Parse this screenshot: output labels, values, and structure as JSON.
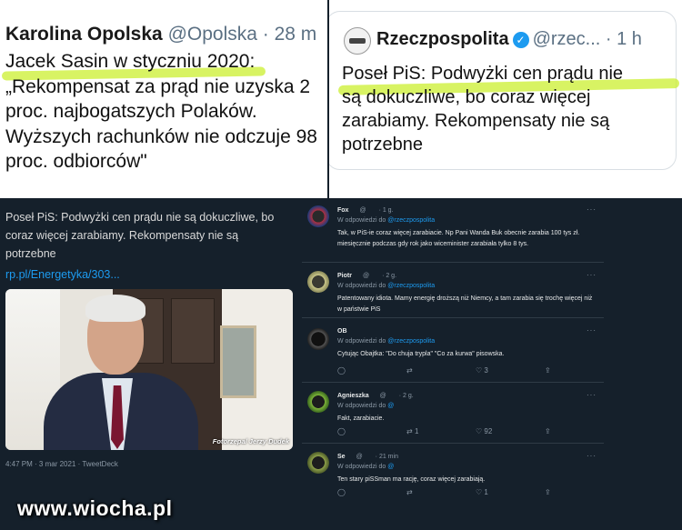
{
  "top_left": {
    "name": "Karolina Opolska",
    "handle": "@Opolska",
    "time": "· 28 m",
    "lines": [
      "Jacek Sasin w styczniu 2020:",
      "„Rekompensat za prąd nie uzyska 2",
      "proc. najbogatszych Polaków.",
      "Wyższych rachunków nie odczuje 98",
      "proc. odbiorców\""
    ]
  },
  "top_right": {
    "name": "Rzeczpospolita",
    "verified": "✓",
    "handle": "@rzec...",
    "time": "· 1 h",
    "lines": [
      "Poseł PiS: Podwyżki cen prądu nie",
      "są dokuczliwe, bo coraz więcej",
      "zarabiamy. Rekompensaty nie są",
      "potrzebne"
    ]
  },
  "main_tweet": {
    "text": "Poseł PiS: Podwyżki cen prądu nie są dokuczliwe, bo coraz więcej zarabiamy. Rekompensaty nie są potrzebne",
    "link": "rp.pl/Energetyka/303...",
    "photo_credit": "Fotorzepa/ Jerzy Dudek",
    "meta": "4:47 PM · 3 mar 2021 · TweetDeck"
  },
  "replies": [
    {
      "name": "Fox",
      "handle": "@",
      "time": "· 1 g.",
      "in_reply_prefix": "W odpowiedzi do ",
      "in_reply_to": "@rzeczpospolita",
      "text": "Tak, w PiS-ie coraz więcej zarabiacie. Np Pani Wanda Buk obecnie zarabia 100 tys zł. miesięcznie podczas gdy rok jako wiceminister zarabiała tylko 8 tys.",
      "avatar_color": "#8a1e2c",
      "actions": {}
    },
    {
      "name": "Piotr",
      "handle": "@",
      "time": "· 2 g.",
      "in_reply_prefix": "W odpowiedzi do ",
      "in_reply_to": "@rzeczpospolita",
      "text": "Patentowany idiota. Mamy energię droższą niż Niemcy, a tam zarabia się trochę więcej niż w państwie PiS",
      "avatar_color": "#c9c68a",
      "actions": {}
    },
    {
      "name": "OB",
      "handle": "",
      "time": "",
      "in_reply_prefix": "W odpowiedzi do ",
      "in_reply_to": "@rzeczpospolita",
      "text": "Cytując Obajtka: \"Do chuja trypla\" \"Co za kurwa\" pisowska.",
      "avatar_color": "#2b2b2b",
      "actions": {
        "reply": "",
        "retweet": "",
        "like": "3"
      }
    },
    {
      "name": "Agnieszka",
      "handle": "@",
      "time": "· 2 g.",
      "in_reply_prefix": "W odpowiedzi do ",
      "in_reply_to": "@",
      "text": "Fakt, zarabiacie.",
      "avatar_color": "#5d8a2a",
      "actions": {
        "reply": "",
        "retweet": "1",
        "like": "92"
      }
    },
    {
      "name": "Se",
      "handle": "@",
      "time": "· 21 min",
      "in_reply_prefix": "W odpowiedzi do ",
      "in_reply_to": "@",
      "text": "Ten stary piSSman ma rację, coraz więcej zarabiają.",
      "avatar_color": "#6a7d3a",
      "actions": {
        "reply": "",
        "retweet": "",
        "like": "1"
      }
    }
  ],
  "icons": {
    "reply": "◯",
    "retweet": "⇄",
    "like": "♡",
    "share": "⇪",
    "more": "···"
  },
  "watermark": "www.wiocha.pl",
  "colors": {
    "highlight": "#cbef2f",
    "link": "#1d9bf0",
    "dark_bg": "#15202b"
  }
}
